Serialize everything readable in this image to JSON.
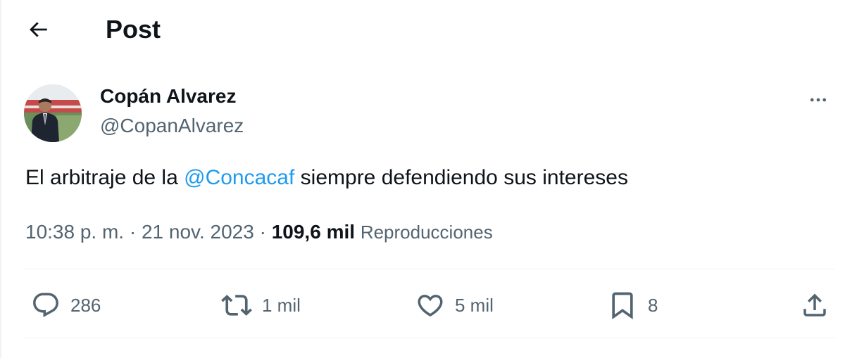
{
  "header": {
    "title": "Post",
    "back_icon": "arrow-left-icon"
  },
  "author": {
    "name": "Copán Alvarez",
    "handle": "@CopanAlvarez",
    "avatar_icon": "stadium-photo-avatar"
  },
  "tweet": {
    "text_before": "El arbitraje de la ",
    "mention": "@Concacaf",
    "text_after": " siempre defendiendo sus intereses",
    "time": "10:38 p. m.",
    "separator": " · ",
    "date": "21 nov. 2023",
    "views_count": "109,6 mil",
    "views_label": "Reproducciones"
  },
  "actions": {
    "replies": "286",
    "reposts": "1 mil",
    "likes": "5 mil",
    "bookmarks": "8"
  },
  "colors": {
    "accent": "#1d9bf0",
    "text": "#0f1419",
    "secondary": "#536471",
    "border": "#eff3f4"
  }
}
